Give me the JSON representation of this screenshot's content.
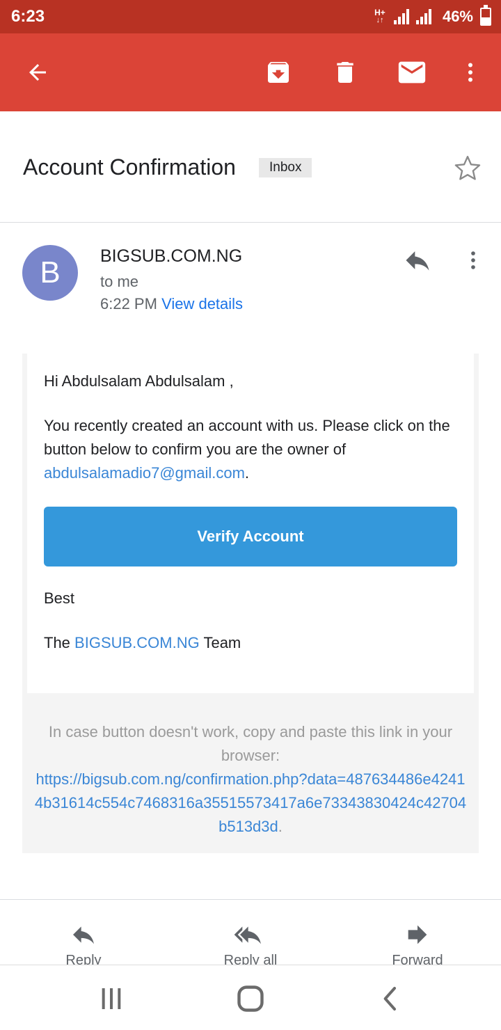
{
  "status_bar": {
    "time": "6:23",
    "network": "H+",
    "battery": "46%",
    "battery_level": 0.46
  },
  "app_bar": {
    "actions": [
      "back-icon",
      "archive-icon",
      "delete-icon",
      "mark-unread-icon",
      "more-vert-icon"
    ]
  },
  "subject": {
    "title": "Account Confirmation",
    "label": "Inbox"
  },
  "sender": {
    "initial": "B",
    "name": "BIGSUB.COM.NG",
    "to": "to me",
    "time": "6:22 PM",
    "details_link": "View details"
  },
  "body": {
    "greeting": "Hi Abdulsalam Abdulsalam ,",
    "paragraph": "You recently created an account with us. Please click on the button below to confirm you are the owner of",
    "email": "abdulsalamadio7@gmail.com",
    "period": ".",
    "button_label": "Verify Account",
    "sign_off": "Best",
    "team_prefix": "The",
    "team_name": "BIGSUB.COM.NG",
    "team_suffix": "Team"
  },
  "fallback": {
    "text": "In case button doesn't work, copy and paste this link in your browser:",
    "url": "https://bigsub.com.ng/confirmation.php?data=487634486e42414b31614c554c7468316a35515573417a6e7334383042​4c42704b513d3d",
    "period": "."
  },
  "bottom_actions": {
    "reply": "Reply",
    "reply_all": "Reply all",
    "forward": "Forward"
  },
  "colors": {
    "status_bar": "#b83223",
    "app_bar": "#db4437",
    "avatar": "#7986cb",
    "button": "#3498db",
    "link": "#3a86d6"
  }
}
